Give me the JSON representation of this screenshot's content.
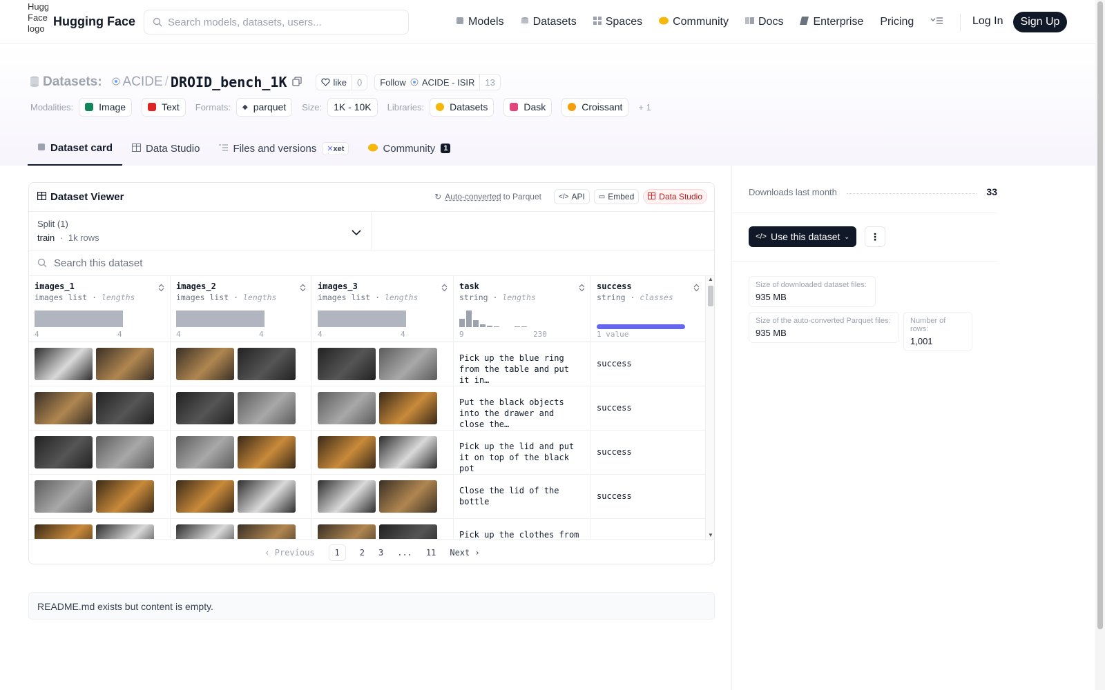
{
  "nav": {
    "logo_alt": "Hugging Face logo",
    "brand": "Hugging Face",
    "search_placeholder": "Search models, datasets, users...",
    "links": [
      "Models",
      "Datasets",
      "Spaces",
      "Community",
      "Docs",
      "Enterprise",
      "Pricing"
    ],
    "login": "Log In",
    "signup": "Sign Up"
  },
  "header": {
    "section_label": "Datasets:",
    "org": "ACIDE",
    "separator": "/",
    "name": "DROID_bench_1K",
    "like_label": "like",
    "like_count": "0",
    "follow_label": "Follow",
    "follow_org": "ACIDE - ISIR",
    "follow_count": "13",
    "modalities_label": "Modalities:",
    "modalities": [
      "Image",
      "Text"
    ],
    "formats_label": "Formats:",
    "format": "parquet",
    "size_label": "Size:",
    "size": "1K - 10K",
    "libraries_label": "Libraries:",
    "libraries": [
      "Datasets",
      "Dask",
      "Croissant"
    ],
    "libraries_more": "+ 1"
  },
  "tabs": {
    "dataset_card": "Dataset card",
    "data_studio": "Data Studio",
    "files": "Files and versions",
    "xet": "xet",
    "community": "Community",
    "community_count": "1"
  },
  "viewer": {
    "title": "Dataset Viewer",
    "auto_converted": "Auto-converted",
    "to_parquet": "to Parquet",
    "api": "API",
    "embed": "Embed",
    "data_studio": "Data Studio",
    "split_label": "Split (1)",
    "split_name": "train",
    "split_dot": "·",
    "split_rows": "1k rows",
    "search_placeholder": "Search this dataset",
    "columns": [
      {
        "name": "images_1",
        "type": "images list",
        "stat": "lengths",
        "min": "4",
        "max": "4"
      },
      {
        "name": "images_2",
        "type": "images list",
        "stat": "lengths",
        "min": "4",
        "max": "4"
      },
      {
        "name": "images_3",
        "type": "images list",
        "stat": "lengths",
        "min": "4",
        "max": "4"
      },
      {
        "name": "task",
        "type": "string",
        "stat": "lengths",
        "min": "9",
        "max": "230"
      },
      {
        "name": "success",
        "type": "string",
        "stat": "classes",
        "min": "1 value",
        "max": ""
      }
    ],
    "rows": [
      {
        "task": "Pick up the blue ring from the table and put it in…",
        "success": "success"
      },
      {
        "task": "Put the black objects into the drawer and close the…",
        "success": "success"
      },
      {
        "task": "Pick up the lid and put it on top of the black pot",
        "success": "success"
      },
      {
        "task": "Close the lid of the bottle",
        "success": "success"
      },
      {
        "task": "Pick up the clothes from",
        "success": ""
      }
    ],
    "pager": {
      "prev": "Previous",
      "pages": [
        "1",
        "2",
        "3",
        "...",
        "11"
      ],
      "next": "Next"
    }
  },
  "readme": "README.md exists but content is empty.",
  "sidebar": {
    "downloads_label": "Downloads last month",
    "downloads": "33",
    "use_dataset": "Use this dataset",
    "stats": [
      {
        "label": "Size of downloaded dataset files:",
        "value": "935 MB"
      },
      {
        "label": "Size of the auto-converted Parquet files:",
        "value": "935 MB"
      },
      {
        "label": "Number of rows:",
        "value": "1,001"
      }
    ]
  },
  "colors": {
    "accent": "#6366f1",
    "dark": "#111827",
    "muted": "#9ca3af",
    "data_studio_red": "#b91c1c"
  }
}
